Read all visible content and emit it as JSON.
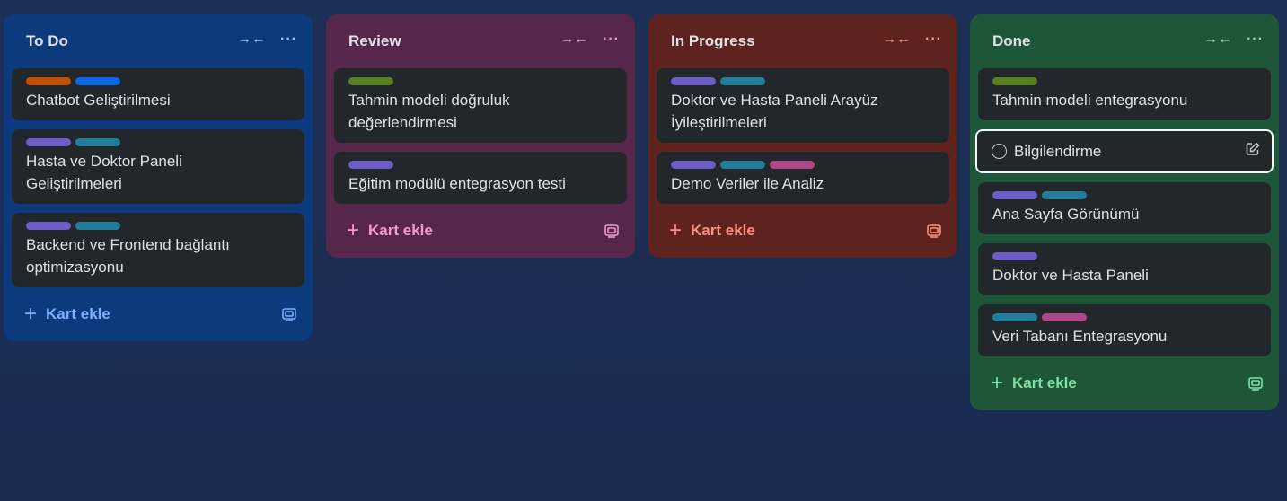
{
  "labels": {
    "orange": "#c25100",
    "blue": "#0c66e4",
    "purple": "#6e5dc6",
    "teal": "#227d9b",
    "green": "#5b7f24",
    "magenta": "#ae4787"
  },
  "columns": {
    "todo": {
      "title": "To Do",
      "collapse_icon": "→←",
      "more_icon": "···",
      "add_label": "Kart ekle",
      "cards": [
        {
          "title": "Chatbot Geliştirilmesi",
          "labels": [
            "orange",
            "blue"
          ]
        },
        {
          "title": "Hasta ve Doktor Paneli Geliştirilmeleri",
          "labels": [
            "purple",
            "teal"
          ]
        },
        {
          "title": "Backend ve Frontend bağlantı optimizasyonu",
          "labels": [
            "purple",
            "teal"
          ]
        }
      ]
    },
    "review": {
      "title": "Review",
      "collapse_icon": "→←",
      "more_icon": "···",
      "add_label": "Kart ekle",
      "cards": [
        {
          "title": "Tahmin modeli doğruluk değerlendirmesi",
          "labels": [
            "green"
          ]
        },
        {
          "title": "Eğitim modülü entegrasyon testi",
          "labels": [
            "purple"
          ]
        }
      ]
    },
    "progress": {
      "title": "In Progress",
      "collapse_icon": "→←",
      "more_icon": "···",
      "add_label": "Kart ekle",
      "cards": [
        {
          "title": "Doktor ve Hasta Paneli Arayüz İyileştirilmeleri",
          "labels": [
            "purple",
            "teal"
          ]
        },
        {
          "title": "Demo Veriler ile Analiz",
          "labels": [
            "purple",
            "teal",
            "magenta"
          ]
        }
      ]
    },
    "done": {
      "title": "Done",
      "collapse_icon": "→←",
      "more_icon": "···",
      "add_label": "Kart ekle",
      "cards": [
        {
          "title": "Tahmin modeli entegrasyonu",
          "labels": [
            "green"
          ]
        },
        {
          "title": "Bilgilendirme",
          "labels": [],
          "selected": true
        },
        {
          "title": "Ana Sayfa Görünümü",
          "labels": [
            "purple",
            "teal"
          ]
        },
        {
          "title": "Doktor ve Hasta Paneli",
          "labels": [
            "purple"
          ]
        },
        {
          "title": "Veri Tabanı Entegrasyonu",
          "labels": [
            "teal",
            "magenta"
          ]
        }
      ]
    }
  }
}
